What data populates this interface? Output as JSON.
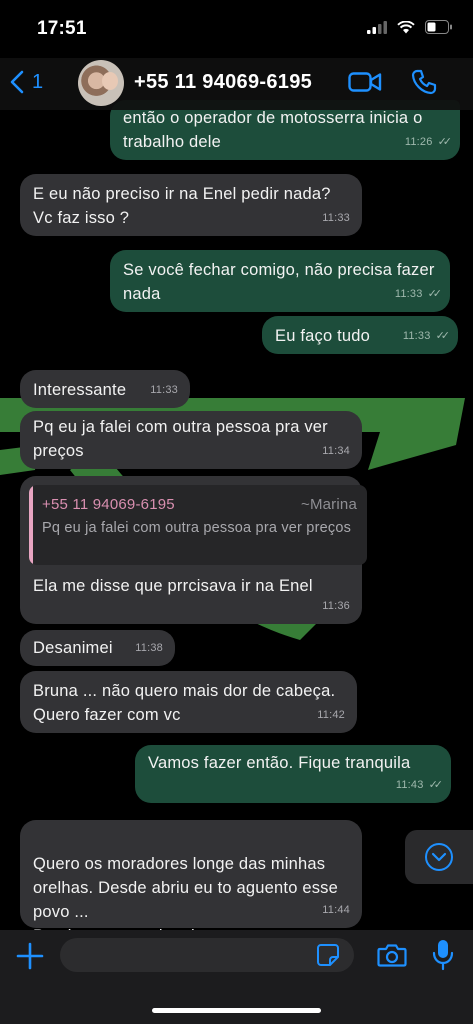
{
  "status": {
    "time": "17:51"
  },
  "header": {
    "back_count": "1",
    "contact": "+55 11 94069-6195"
  },
  "messages": [
    {
      "dir": "out",
      "text": "então o operador de motosserra inicia o trabalho dele",
      "time": "11:26"
    },
    {
      "dir": "in",
      "text": "E eu não preciso ir na Enel pedir nada? Vc faz isso ?",
      "time": "11:33"
    },
    {
      "dir": "out",
      "text": "Se você fechar comigo, não precisa fazer nada",
      "time": "11:33"
    },
    {
      "dir": "out",
      "text": "Eu faço tudo",
      "time": "11:33"
    },
    {
      "dir": "in",
      "text": "Interessante",
      "time": "11:33"
    },
    {
      "dir": "in",
      "text": "Pq eu ja falei com outra pessoa pra ver preços",
      "time": "11:34"
    },
    {
      "dir": "in",
      "text": "Ela me disse que prrcisava ir na Enel",
      "time": "11:36",
      "quote": {
        "name": "+55 11 94069-6195",
        "alias": "~Marina",
        "text": "Pq eu ja falei com outra pessoa pra ver preços"
      }
    },
    {
      "dir": "in",
      "text": "Desanimei",
      "time": "11:38"
    },
    {
      "dir": "in",
      "text": "Bruna ... não quero mais dor de cabeça. Quero fazer com vc",
      "time": "11:42"
    },
    {
      "dir": "out",
      "text": "Vamos fazer então. Fique tranquila",
      "time": "11:43"
    },
    {
      "dir": "in",
      "text": "Quero os moradores longe das minhas orelhas. Desde abriu eu to aguento esse povo ...\nPrecisamos resolver logo",
      "time": "11:44"
    }
  ],
  "input": {
    "placeholder": ""
  },
  "colors": {
    "accent": "#1e90ff",
    "outgoing": "#1d4d3b",
    "incoming": "#333336",
    "quote_name": "#d98fb0",
    "wallpaper": "#3d8b3d"
  },
  "icons": [
    "signal-icon",
    "wifi-icon",
    "battery-icon",
    "back-chevron-icon",
    "video-call-icon",
    "phone-icon",
    "scroll-down-icon",
    "plus-icon",
    "sticker-icon",
    "camera-icon",
    "microphone-icon"
  ]
}
